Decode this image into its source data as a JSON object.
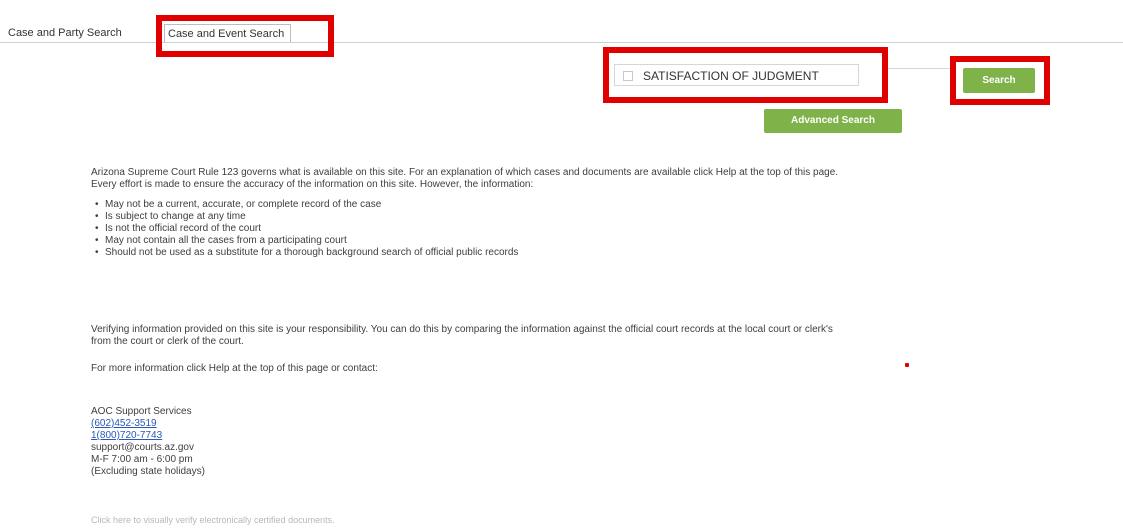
{
  "tabs": [
    {
      "label": "Case and Party Search"
    },
    {
      "label": "Case and Event Search"
    }
  ],
  "search": {
    "value": "SATISFACTION OF JUDGMENT",
    "button_label": "Search",
    "advanced_label": "Advanced Search"
  },
  "intro": {
    "line1": "Arizona Supreme Court Rule 123 governs what is available on this site. For an explanation of which cases and documents are available click Help at the top of this page.",
    "line2": "Every effort is made to ensure the accuracy of the information on this site. However, the information:"
  },
  "bullets": [
    "May not be a current, accurate, or complete record of the case",
    "Is subject to change at any time",
    "Is not the official record of the court",
    "May not contain all the cases from a participating court",
    "Should not be used as a substitute for a thorough background search of official public records"
  ],
  "verify": {
    "line1": "Verifying information provided on this site is your responsibility. You can do this by comparing the information against the official court records at the local court or clerk's",
    "line2": "from the court or clerk of the court."
  },
  "more_info": "For more information click Help at the top of this page or contact:",
  "contact": {
    "org": "AOC Support Services",
    "phone1": "(602)452-3519",
    "phone2": "1(800)720-7743",
    "email": "support@courts.az.gov",
    "hours": "M-F 7:00 am - 6:00 pm",
    "note": "(Excluding state holidays)"
  },
  "footer_link": "Click here to visually verify electronically certified documents."
}
